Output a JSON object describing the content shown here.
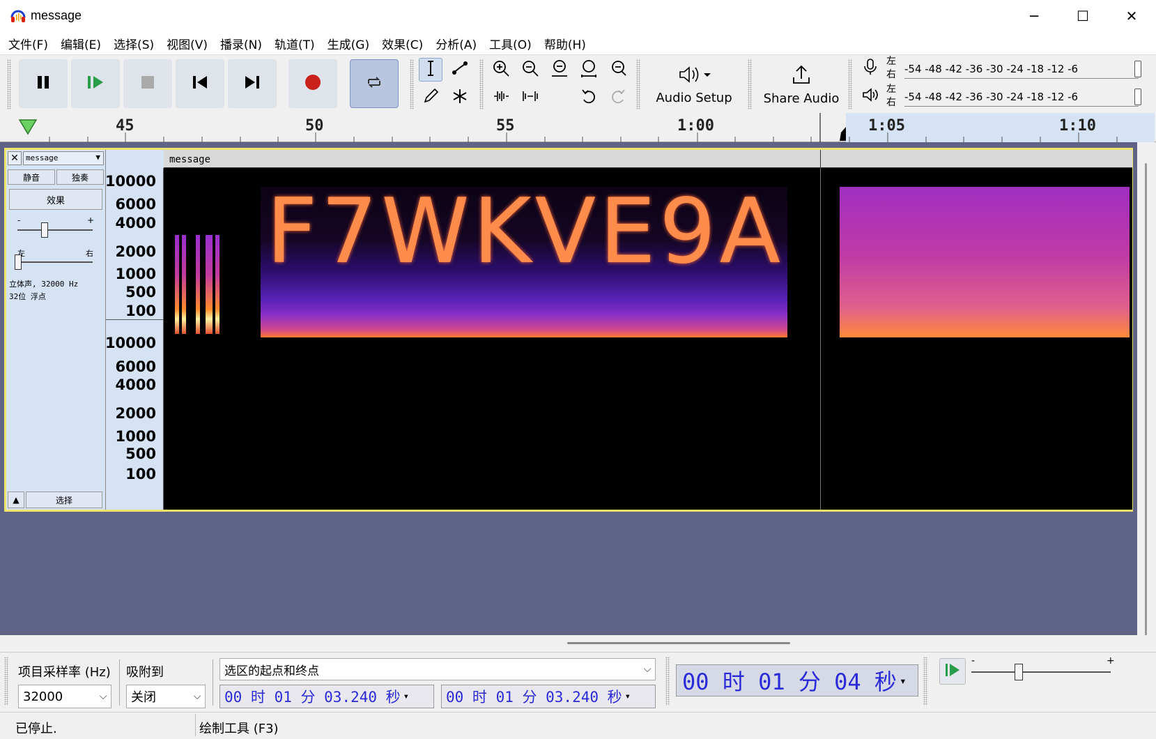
{
  "window": {
    "title": "message",
    "icon": "audacity-headphones-icon"
  },
  "window_controls": {
    "minimize": "─",
    "maximize": "☐",
    "close": "✕"
  },
  "menu": [
    "文件(F)",
    "编辑(E)",
    "选择(S)",
    "视图(V)",
    "播录(N)",
    "轨道(T)",
    "生成(G)",
    "效果(C)",
    "分析(A)",
    "工具(O)",
    "帮助(H)"
  ],
  "toolbar": {
    "audio_setup": "Audio Setup",
    "share_audio": "Share Audio",
    "meter_left": "左",
    "meter_right": "右",
    "meter_scale": "-54 -48 -42 -36 -30 -24 -18 -12 -6"
  },
  "ruler": {
    "labels": [
      "45",
      "50",
      "55",
      "1:00",
      "1:05",
      "1:10"
    ]
  },
  "track": {
    "name": "message",
    "mute": "静音",
    "solo": "独奏",
    "effects": "效果",
    "gain_minus": "-",
    "gain_plus": "+",
    "pan_left": "左",
    "pan_right": "右",
    "info_line1": "立体声, 32000 Hz",
    "info_line2": "32位 浮点",
    "select": "选择",
    "clip_name": "message",
    "freq_labels_top": [
      "10000",
      "6000",
      "4000",
      "2000",
      "1000",
      "500",
      "100"
    ],
    "freq_labels_bottom": [
      "10000",
      "6000",
      "4000",
      "2000",
      "1000",
      "500",
      "100"
    ],
    "spectrogram_text": "F7WKVE9A"
  },
  "bottom": {
    "rate_label": "项目采样率 (Hz)",
    "rate_value": "32000",
    "snap_label": "吸附到",
    "snap_value": "关闭",
    "selection_mode": "选区的起点和终点",
    "sel_start": "00 时 01 分 03.240 秒",
    "sel_end": "00 时 01 分 03.240 秒",
    "position": "00 时 01 分 04 秒",
    "speed_minus": "-",
    "speed_plus": "+"
  },
  "status": {
    "state": "已停止.",
    "tool": "绘制工具 (F3)"
  },
  "colors": {
    "accent_blue": "#2a2ad8",
    "track_bg": "#5f6487",
    "selection": "#d5e3f5",
    "track_border": "#eee36b"
  }
}
